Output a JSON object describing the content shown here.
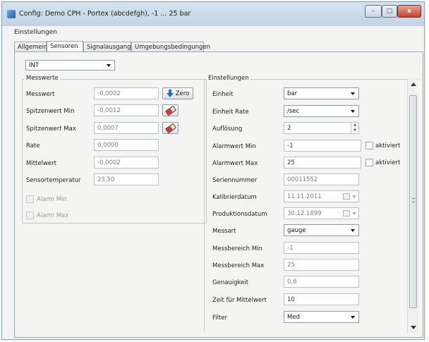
{
  "window": {
    "title": "Config: Demo CPH - Portex (abcdefgh), -1 ... 25 bar",
    "buttons": {
      "minimize": "–",
      "maximize": "□",
      "close": "x"
    }
  },
  "group_label": "Einstellungen",
  "tabs": [
    {
      "label": "Allgemein",
      "active": false
    },
    {
      "label": "Sensoren",
      "active": true
    },
    {
      "label": "Signalausgang",
      "active": false
    },
    {
      "label": "Umgebungsbedingungen",
      "active": false
    }
  ],
  "sensor_select": {
    "value": "INT"
  },
  "messwerte": {
    "title": "Messwerte",
    "rows": [
      {
        "label": "Messwert",
        "value": "-0,0002"
      },
      {
        "label": "Spitzenwert Min",
        "value": "-0,0012"
      },
      {
        "label": "Spitzenwert Max",
        "value": "0,0007"
      },
      {
        "label": "Rate",
        "value": "0,0000"
      },
      {
        "label": "Mittelwert",
        "value": "-0,0002"
      },
      {
        "label": "Sensortemperatur",
        "value": "23,50"
      }
    ],
    "zero_button": "Zero",
    "alarm_min": "Alarm Min",
    "alarm_max": "Alarm Max"
  },
  "einstellungen": {
    "title": "Einstellungen",
    "einheit": {
      "label": "Einheit",
      "value": "bar"
    },
    "einheit_rate": {
      "label": "Einheit Rate",
      "value": "/sec"
    },
    "aufloesung": {
      "label": "Auflösung",
      "value": "2"
    },
    "alarmwert_min": {
      "label": "Alarmwert Min",
      "value": "-1",
      "checkbox": "aktiviert"
    },
    "alarmwert_max": {
      "label": "Alarmwert Max",
      "value": "25",
      "checkbox": "aktiviert"
    },
    "seriennummer": {
      "label": "Seriennummer",
      "value": "00011552"
    },
    "kalibrierdatum": {
      "label": "Kalibrierdatum",
      "value": "11.11.2011"
    },
    "produktionsdatum": {
      "label": "Produktionsdatum",
      "value": "30.12.1899"
    },
    "messart": {
      "label": "Messart",
      "value": "gauge"
    },
    "messbereich_min": {
      "label": "Messbereich Min",
      "value": "-1"
    },
    "messbereich_max": {
      "label": "Messbereich Max",
      "value": "25"
    },
    "genauigkeit": {
      "label": "Genauigkeit",
      "value": "0,6"
    },
    "zeit_mittelwert": {
      "label": "Zeit für Mittelwert",
      "value": "10"
    },
    "filter": {
      "label": "Filter",
      "value": "Med"
    }
  }
}
